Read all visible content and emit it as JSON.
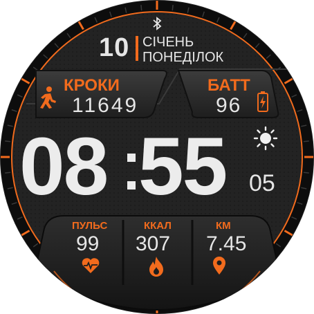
{
  "date": {
    "day": "10",
    "month": "СІЧЕНЬ",
    "weekday": "ПОНЕДІЛОК"
  },
  "steps": {
    "label": "КРОКИ",
    "value": "11649"
  },
  "battery": {
    "label": "БАТТ",
    "value": "96"
  },
  "time": {
    "hours": "08",
    "minutes": "55",
    "seconds": "05"
  },
  "stats": [
    {
      "label": "ПУЛЬС",
      "value": "99",
      "icon": "heart-pulse-icon"
    },
    {
      "label": "ККАЛ",
      "value": "307",
      "icon": "flame-icon"
    },
    {
      "label": "КМ",
      "value": "7.45",
      "icon": "location-pin-icon"
    }
  ],
  "status_icons": [
    "bluetooth-icon",
    "weather-sun-icon",
    "walking-person-icon",
    "battery-charging-icon"
  ],
  "colors": {
    "accent": "#f26b1d",
    "text": "#e6e6e6",
    "bezel": "#0f0f0f"
  }
}
